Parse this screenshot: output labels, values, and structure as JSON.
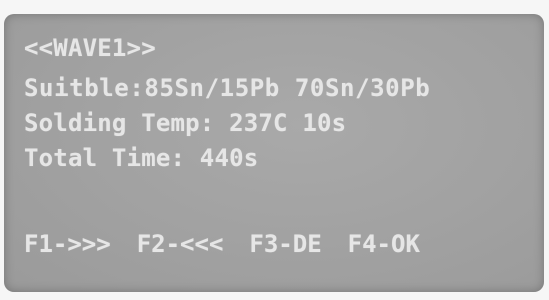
{
  "screen": {
    "title": "<<WAVE1>>",
    "suitable": "Suitble:85Sn/15Pb 70Sn/30Pb",
    "solding_temp": "Solding Temp: 237C 10s",
    "total_time": "Total Time: 440s"
  },
  "function_keys": {
    "f1": "F1->>>",
    "f2": "F2-<<<",
    "f3": "F3-DE",
    "f4": "F4-OK"
  }
}
